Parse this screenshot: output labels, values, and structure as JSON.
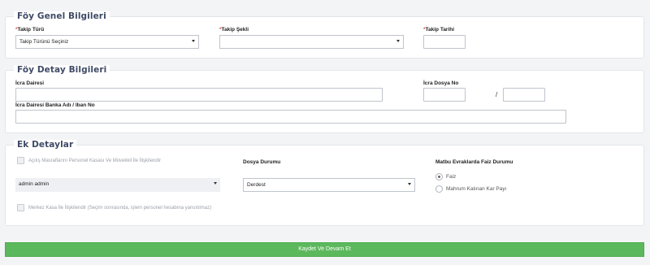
{
  "genel": {
    "legend": "Föy Genel Bilgileri",
    "takip_turu": {
      "label": "Takip Türü",
      "value": "Takip Türünü Seçiniz"
    },
    "takip_sekli": {
      "label": "Takip Şekli",
      "value": ""
    },
    "takip_tarihi": {
      "label": "Takip Tarihi",
      "value": ""
    },
    "required_mark": "*"
  },
  "detay": {
    "legend": "Föy Detay Bilgileri",
    "icra_dairesi": {
      "label": "İcra Dairesi",
      "value": ""
    },
    "icra_dosya_no": {
      "label": "İcra Dosya No",
      "value1": "",
      "value2": "",
      "separator": "/"
    },
    "banka_iban": {
      "label": "İcra Dairesi Banka Adı / Iban No",
      "value": ""
    }
  },
  "ek": {
    "legend": "Ek Detaylar",
    "cb_masraf": {
      "label": "Açılış Masraflarını Personel Kasası Ve Müvekkil İle İlişkilendir",
      "checked": false
    },
    "personel_select": {
      "value": "admin admin"
    },
    "cb_merkez": {
      "label": "Merkez Kasa İle İlişkilendir (Seçim sonrasında, işlem personel hesabına yansıtılmaz)",
      "checked": false
    },
    "dosya_durumu": {
      "label": "Dosya Durumu",
      "value": "Derdest"
    },
    "faiz_durumu": {
      "label": "Matbu Evraklarda Faiz Durumu",
      "options": [
        {
          "label": "Faiz",
          "selected": true
        },
        {
          "label": "Mahrum Kalınan Kar Payı",
          "selected": false
        }
      ]
    }
  },
  "submit": {
    "label": "Kaydet Ve Devam Et"
  },
  "colors": {
    "accent_green": "#5cb85c",
    "legend_text": "#3f4a66",
    "required": "#d9534f"
  }
}
